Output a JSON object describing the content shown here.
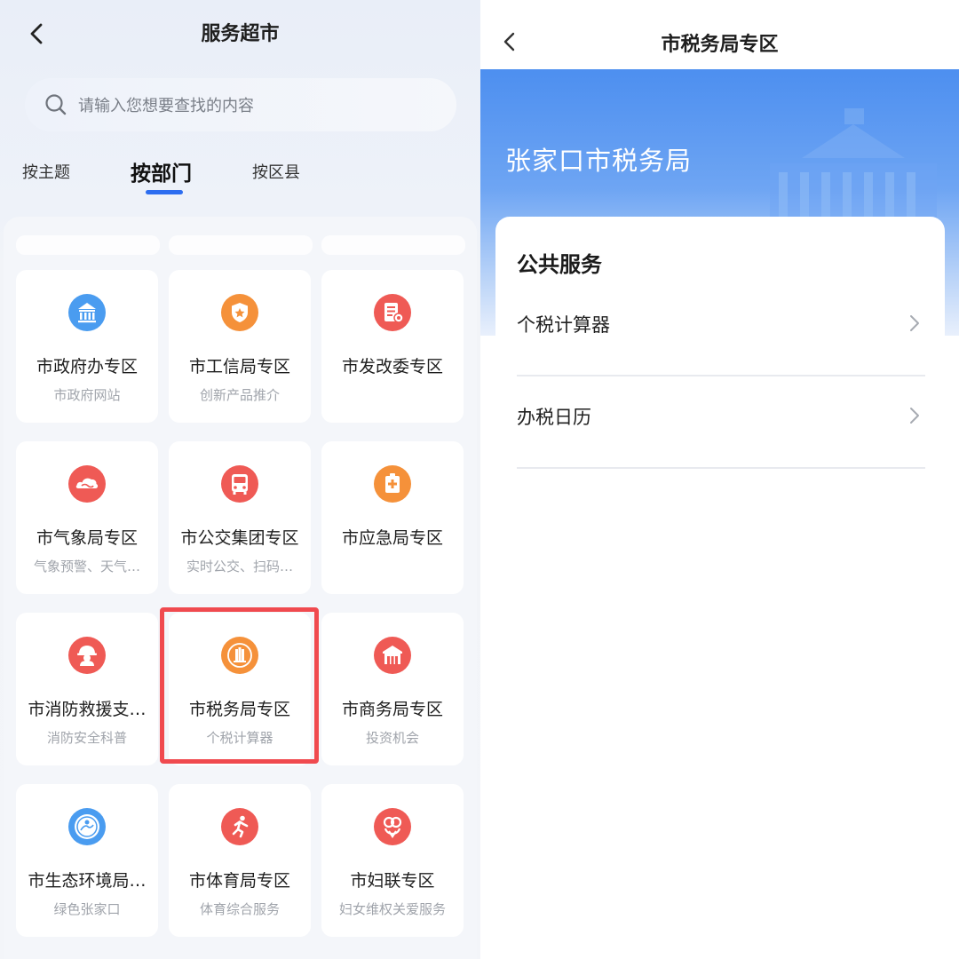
{
  "left": {
    "title": "服务超市",
    "search_placeholder": "请输入您想要查找的内容",
    "tabs": [
      {
        "label": "按主题"
      },
      {
        "label": "按部门"
      },
      {
        "label": "按区县"
      }
    ],
    "active_tab": "按部门",
    "cards": [
      {
        "name": "市政府办专区",
        "sub": "市政府网站",
        "icon": "government-building-icon",
        "color": "#4a9cf0"
      },
      {
        "name": "市工信局专区",
        "sub": "创新产品推介",
        "icon": "shield-badge-icon",
        "color": "#f5913a"
      },
      {
        "name": "市发改委专区",
        "sub": "",
        "icon": "document-icon",
        "color": "#ef5a55"
      },
      {
        "name": "市气象局专区",
        "sub": "气象预警、天气…",
        "icon": "cloud-icon",
        "color": "#ef5a55"
      },
      {
        "name": "市公交集团专区",
        "sub": "实时公交、扫码…",
        "icon": "bus-icon",
        "color": "#ef5a55"
      },
      {
        "name": "市应急局专区",
        "sub": "",
        "icon": "emergency-icon",
        "color": "#f5913a"
      },
      {
        "name": "市消防救援支…",
        "sub": "消防安全科普",
        "icon": "firefighter-icon",
        "color": "#ef5a55"
      },
      {
        "name": "市税务局专区",
        "sub": "个税计算器",
        "icon": "tax-emblem-icon",
        "color": "#f5913a"
      },
      {
        "name": "市商务局专区",
        "sub": "投资机会",
        "icon": "commerce-building-icon",
        "color": "#ef5a55"
      },
      {
        "name": "市生态环境局…",
        "sub": "绿色张家口",
        "icon": "ecology-emblem-icon",
        "color": "#4a9cf0"
      },
      {
        "name": "市体育局专区",
        "sub": "体育综合服务",
        "icon": "running-icon",
        "color": "#ef5a55"
      },
      {
        "name": "市妇联专区",
        "sub": "妇女维权关爱服务",
        "icon": "women-federation-icon",
        "color": "#ef5a55"
      }
    ],
    "highlight_color": "#f04a4f"
  },
  "right": {
    "title": "市税务局专区",
    "banner_title": "张家口市税务局",
    "section_title": "公共服务",
    "rows": [
      {
        "label": "个税计算器"
      },
      {
        "label": "办税日历"
      }
    ],
    "accent": "#4d8ff0"
  }
}
